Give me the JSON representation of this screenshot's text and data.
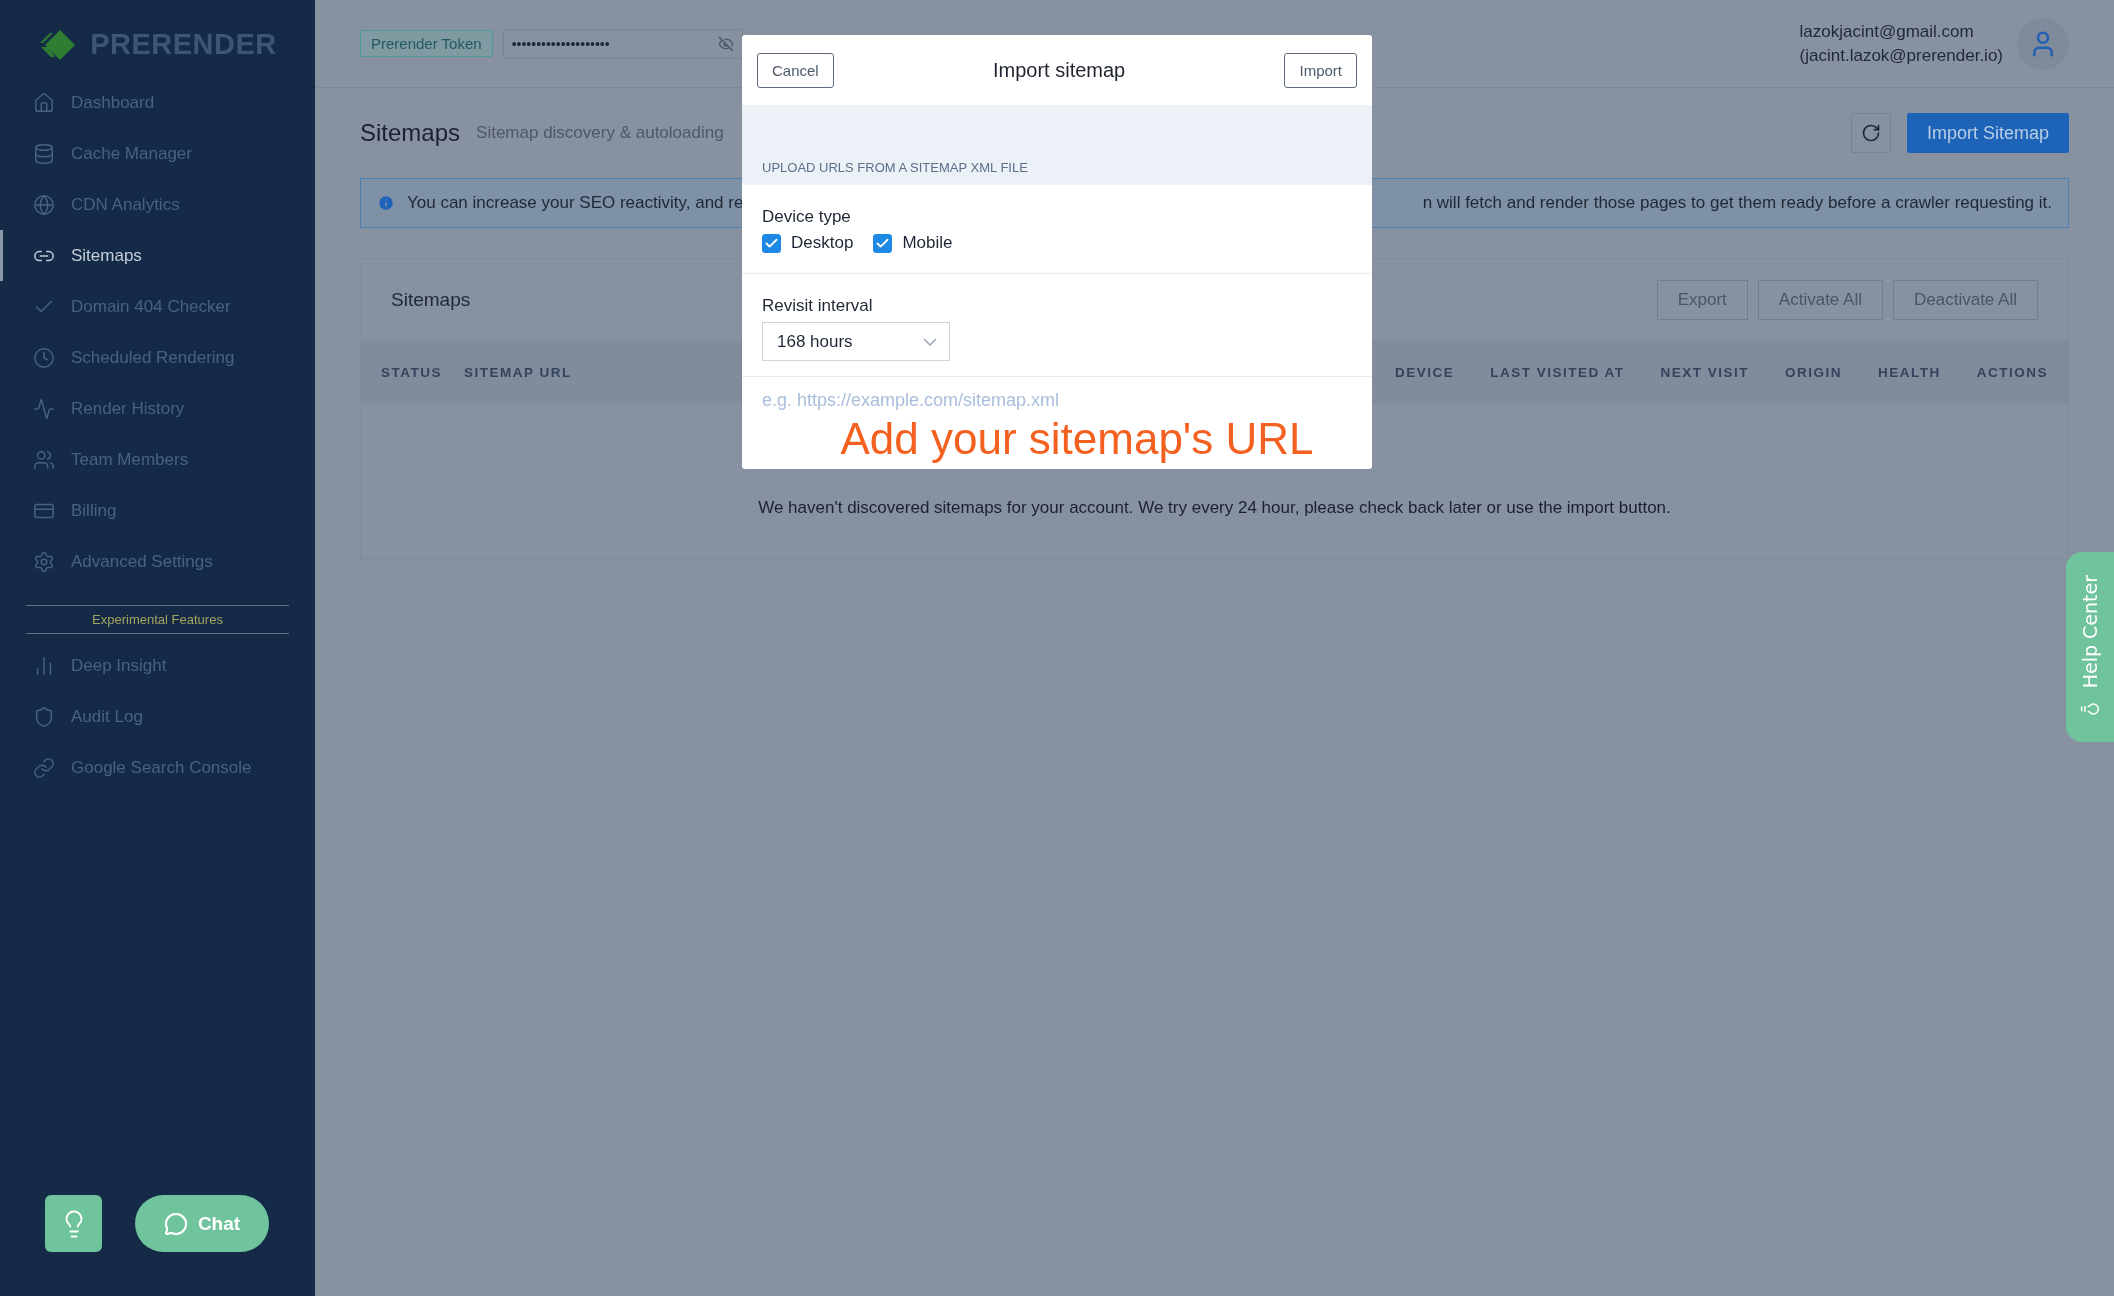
{
  "sidebar": {
    "logo": "PRERENDER",
    "items": [
      {
        "label": "Dashboard",
        "selected": false
      },
      {
        "label": "Cache Manager",
        "selected": false
      },
      {
        "label": "CDN Analytics",
        "selected": false
      },
      {
        "label": "Sitemaps",
        "selected": true
      },
      {
        "label": "Domain 404 Checker",
        "selected": false
      },
      {
        "label": "Scheduled Rendering",
        "selected": false
      },
      {
        "label": "Render History",
        "selected": false
      },
      {
        "label": "Team Members",
        "selected": false
      },
      {
        "label": "Billing",
        "selected": false
      },
      {
        "label": "Advanced Settings",
        "selected": false
      }
    ],
    "section_label": "Experimental Features",
    "experimental_items": [
      {
        "label": "Deep Insight",
        "selected": false
      },
      {
        "label": "Audit Log",
        "selected": false
      },
      {
        "label": "Google Search Console",
        "selected": false
      }
    ],
    "chat_button": "Chat"
  },
  "header": {
    "token_label": "Prerender Token",
    "token_value": "••••••••••••••••••••",
    "user_email": "lazokjacint@gmail.com",
    "user_alias": "(jacint.lazok@prerender.io)"
  },
  "page": {
    "title": "Sitemaps",
    "subtitle": "Sitemap discovery & autoloading",
    "import_button": "Import Sitemap",
    "info_text_start": "You can increase your SEO reactivity, and re",
    "info_text_end": "n will fetch and render those pages to get them ready before a crawler requesting it."
  },
  "card": {
    "title": "Sitemaps",
    "actions": [
      {
        "label": "Export",
        "disabled": true
      },
      {
        "label": "Activate All",
        "disabled": true
      },
      {
        "label": "Deactivate All",
        "disabled": true
      }
    ],
    "columns_left": [
      "STATUS",
      "SITEMAP URL"
    ],
    "columns_right": [
      "DEVICE",
      "LAST VISITED AT",
      "NEXT VISIT",
      "ORIGIN",
      "HEALTH",
      "ACTIONS"
    ],
    "empty_message": "We haven't discovered sitemaps for your account. We try every 24 hour, please check back later or use the import button."
  },
  "modal": {
    "title": "Import sitemap",
    "cancel": "Cancel",
    "confirm": "Import",
    "section_label": "UPLOAD URLS FROM A SITEMAP XML FILE",
    "device_label": "Device type",
    "devices": [
      {
        "label": "Desktop",
        "checked": true
      },
      {
        "label": "Mobile",
        "checked": true
      }
    ],
    "interval_label": "Revisit interval",
    "interval_value": "168 hours",
    "url_placeholder": "e.g. https://example.com/sitemap.xml"
  },
  "annotation": "Add your sitemap's URL",
  "help_center": "Help Center"
}
